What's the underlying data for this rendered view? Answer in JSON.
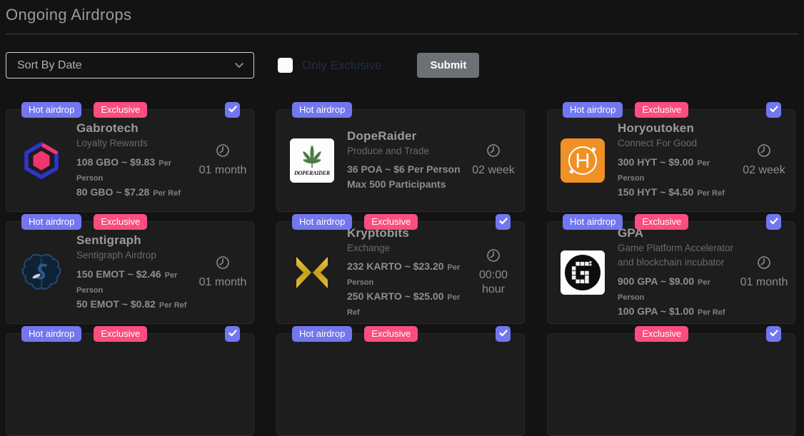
{
  "page": {
    "title": "Ongoing Airdrops"
  },
  "controls": {
    "sort_select_value": "Sort By Date",
    "only_exclusive_label": "Only Exclusive",
    "submit_label": "Submit"
  },
  "badge_labels": {
    "hot": "Hot airdrop",
    "exclusive": "Exclusive"
  },
  "colors": {
    "accent_purple": "#7277f0",
    "accent_pink": "#fb4d7f",
    "submit_gray": "#6d7176",
    "page_background": "#131313",
    "card_background": "#1d1d1d"
  },
  "cards": [
    {
      "name": "Gabrotech",
      "subtitle": "Loyalty Rewards",
      "logo": "gabrotech-hexagon-logo",
      "badges": {
        "hot": true,
        "exclusive": true
      },
      "checked": true,
      "lines": [
        {
          "value": "108 GBO ~ $9.83",
          "suffix": "Per Person"
        },
        {
          "value": "80 GBO ~ $7.28",
          "suffix": "Per Ref"
        }
      ],
      "duration": [
        "01 month"
      ]
    },
    {
      "name": "DopeRaider",
      "subtitle": "Produce and Trade",
      "logo": "doperaider-leaf-logo",
      "badges": {
        "hot": true,
        "exclusive": false
      },
      "checked": false,
      "lines": [
        {
          "value": "36 POA ~ $6 Per Person",
          "suffix": ""
        },
        {
          "value": "Max 500 Participants",
          "suffix": ""
        }
      ],
      "duration": [
        "02 week"
      ]
    },
    {
      "name": "Horyoutoken",
      "subtitle": "Connect For Good",
      "logo": "horyoutoken-h-logo",
      "badges": {
        "hot": true,
        "exclusive": true
      },
      "checked": true,
      "lines": [
        {
          "value": "300 HYT ~ $9.00",
          "suffix": "Per Person"
        },
        {
          "value": "150 HYT ~ $4.50",
          "suffix": "Per Ref"
        }
      ],
      "duration": [
        "02 week"
      ]
    },
    {
      "name": "Sentigraph",
      "subtitle": "Sentigraph Airdrop",
      "logo": "sentigraph-brain-logo",
      "badges": {
        "hot": true,
        "exclusive": true
      },
      "checked": false,
      "lines": [
        {
          "value": "150 EMOT ~ $2.46",
          "suffix": "Per Person"
        },
        {
          "value": "50 EMOT ~ $0.82",
          "suffix": "Per Ref"
        }
      ],
      "duration": [
        "01 month"
      ]
    },
    {
      "name": "Kryptobits",
      "subtitle": "Exchange",
      "logo": "kryptobits-x-logo",
      "badges": {
        "hot": true,
        "exclusive": true
      },
      "checked": true,
      "lines": [
        {
          "value": "232 KARTO ~ $23.20",
          "suffix": "Per Person"
        },
        {
          "value": "250 KARTO ~ $25.00",
          "suffix": "Per Ref"
        }
      ],
      "duration": [
        "00:00",
        "hour"
      ]
    },
    {
      "name": "GPA",
      "subtitle": "Game Platform Accelerator and blockchain incubator",
      "logo": "gpa-g-logo",
      "badges": {
        "hot": true,
        "exclusive": true
      },
      "checked": true,
      "lines": [
        {
          "value": "900 GPA ~ $9.00",
          "suffix": "Per Person"
        },
        {
          "value": "100 GPA ~ $1.00",
          "suffix": "Per Ref"
        }
      ],
      "duration": [
        "01 month"
      ]
    }
  ],
  "partial_cards": [
    {
      "badges": {
        "hot": true,
        "exclusive": true
      },
      "checked": true
    },
    {
      "badges": {
        "hot": true,
        "exclusive": true
      },
      "checked": true
    },
    {
      "badges": {
        "hot": false,
        "exclusive": true
      },
      "checked": true
    }
  ]
}
